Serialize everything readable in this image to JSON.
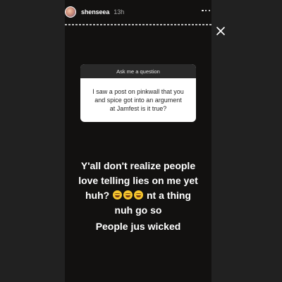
{
  "header": {
    "username": "shenseea",
    "time": "13h"
  },
  "question_card": {
    "title": "Ask me a question",
    "question_lines": [
      "I saw a post on pinkwall that you",
      "and spice got into an argument",
      "at Jamfest is it true?"
    ]
  },
  "caption": {
    "line1": "Y'all don't realize people",
    "line2": "love telling lies on me yet",
    "line3_before": "huh?",
    "line3_after": "nt a thing",
    "line4": "nuh go so",
    "line5": "People jus wicked",
    "emojis": [
      "rofl-emoji",
      "joy-emoji",
      "joy-emoji"
    ]
  },
  "colors": {
    "story_background": "#121110",
    "outer_background": "#212121",
    "card_header": "#2a2a2a",
    "card_body": "#ffffff",
    "text": "#ffffff"
  }
}
